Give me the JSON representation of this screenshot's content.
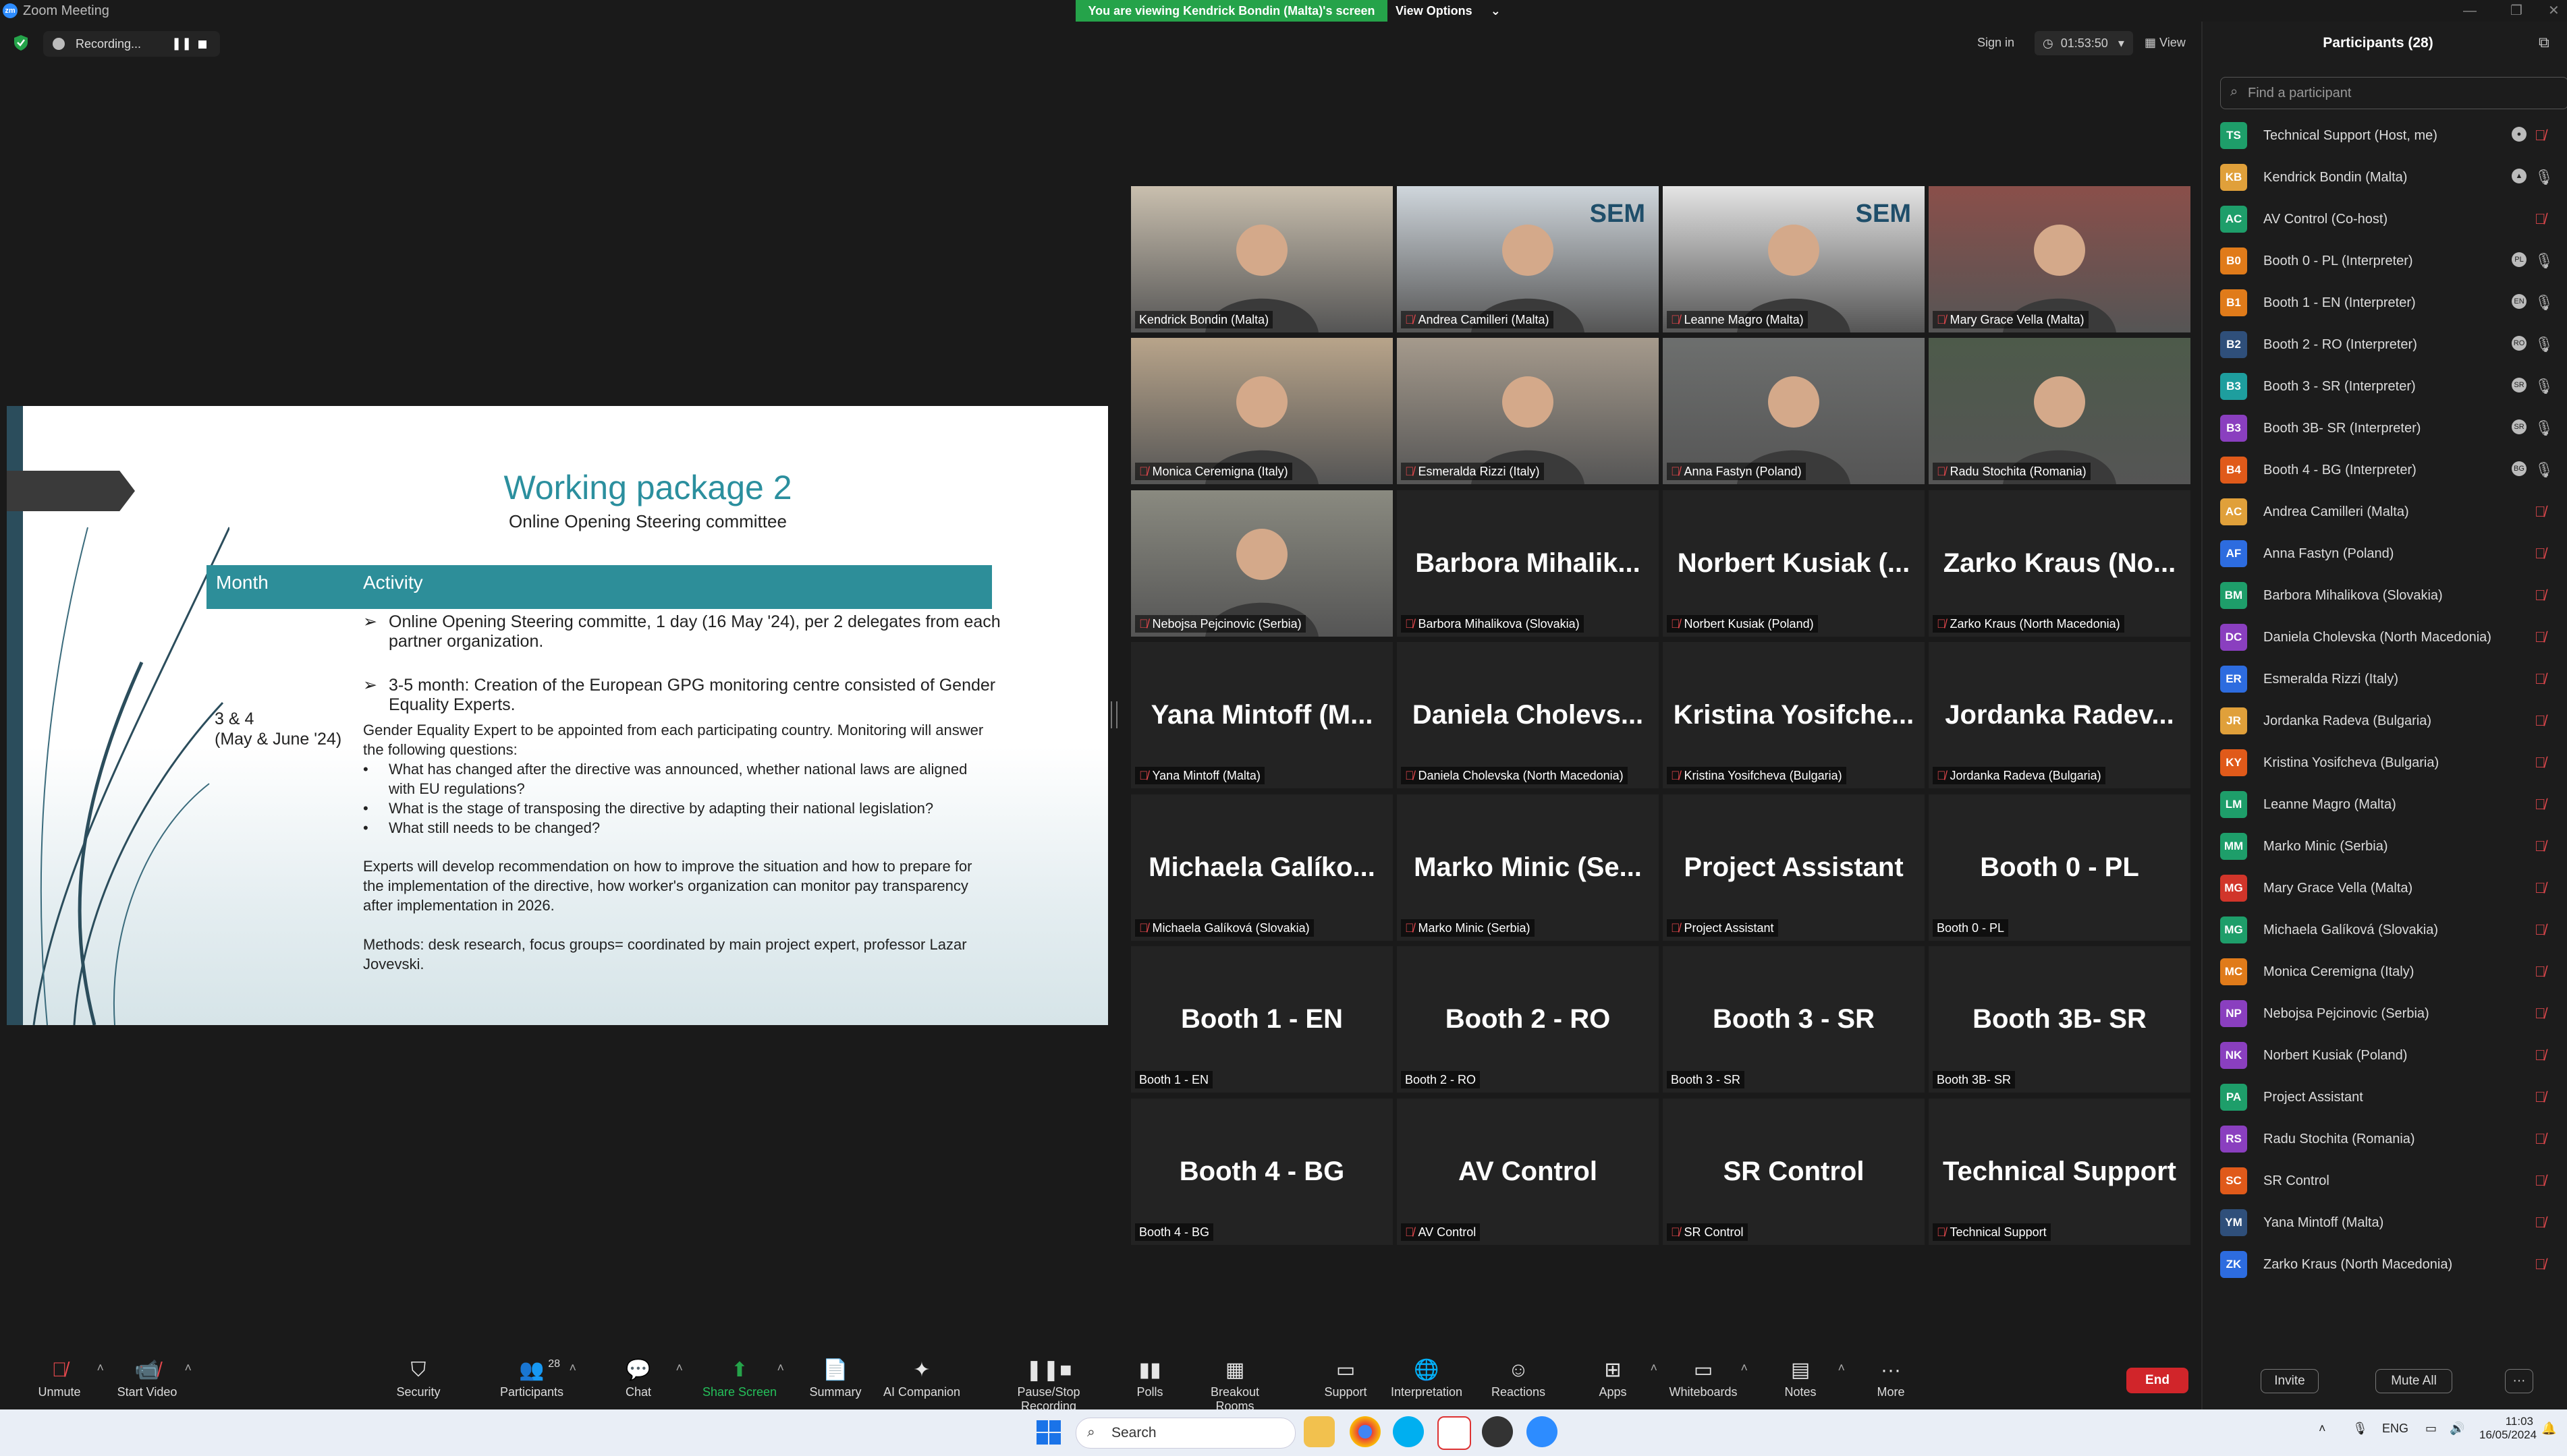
{
  "window": {
    "title": "Zoom Meeting"
  },
  "banner": {
    "text": "You are viewing Kendrick Bondin (Malta)'s screen",
    "view_options": "View Options"
  },
  "recording": {
    "label": "Recording..."
  },
  "topbar": {
    "sign_in": "Sign in",
    "timer": "01:53:50",
    "view": "View"
  },
  "slide": {
    "title": "Working package 2",
    "subtitle": "Online Opening Steering committee",
    "col_month": "Month",
    "col_activity": "Activity",
    "month_value": "3 & 4",
    "month_sub": "(May & June '24)",
    "bullet1": "Online Opening Steering committe, 1 day (16 May '24), per 2 delegates from each partner organization.",
    "bullet2": "3-5 month: Creation of the European GPG monitoring centre consisted of Gender Equality Experts.",
    "para1": "Gender Equality Expert to be appointed from each participating country. Monitoring will answer the following questions:",
    "q1": "What has changed after the directive was announced, whether national laws are aligned with EU regulations?",
    "q2": "What is the stage of transposing the directive by adapting their national legislation?",
    "q3": "What still needs to be changed?",
    "para2": "Experts will develop recommendation on how to improve the situation and how to prepare for the implementation of the directive, how worker's organization can monitor pay transparency after implementation in 2026.",
    "para3": "Methods: desk research, focus groups= coordinated by main project expert, professor Lazar Jovevski."
  },
  "tiles": [
    {
      "big": "",
      "label": "Kendrick Bondin (Malta)",
      "muted": false,
      "video": true,
      "active": true
    },
    {
      "big": "",
      "label": "Andrea Camilleri (Malta)",
      "muted": true,
      "video": true,
      "logo": "SEM"
    },
    {
      "big": "",
      "label": "Leanne Magro (Malta)",
      "muted": true,
      "video": true,
      "logo": "SEM"
    },
    {
      "big": "",
      "label": "Mary Grace Vella (Malta)",
      "muted": true,
      "video": true
    },
    {
      "big": "",
      "label": "Monica Ceremigna (Italy)",
      "muted": true,
      "video": true
    },
    {
      "big": "",
      "label": "Esmeralda Rizzi (Italy)",
      "muted": true,
      "video": true
    },
    {
      "big": "",
      "label": "Anna Fastyn (Poland)",
      "muted": true,
      "video": true
    },
    {
      "big": "",
      "label": "Radu Stochita (Romania)",
      "muted": true,
      "video": true
    },
    {
      "big": "",
      "label": "Nebojsa Pejcinovic (Serbia)",
      "muted": true,
      "video": true
    },
    {
      "big": "Barbora Mihalik...",
      "label": "Barbora Mihalikova (Slovakia)",
      "muted": true
    },
    {
      "big": "Norbert Kusiak (...",
      "label": "Norbert Kusiak (Poland)",
      "muted": true
    },
    {
      "big": "Zarko Kraus (No...",
      "label": "Zarko Kraus (North Macedonia)",
      "muted": true
    },
    {
      "big": "Yana Mintoff (M...",
      "label": "Yana Mintoff (Malta)",
      "muted": true
    },
    {
      "big": "Daniela Cholevs...",
      "label": "Daniela Cholevska (North Macedonia)",
      "muted": true
    },
    {
      "big": "Kristina Yosifche...",
      "label": "Kristina Yosifcheva (Bulgaria)",
      "muted": true
    },
    {
      "big": "Jordanka Radev...",
      "label": "Jordanka Radeva (Bulgaria)",
      "muted": true
    },
    {
      "big": "Michaela Galíko...",
      "label": "Michaela Galíková (Slovakia)",
      "muted": true
    },
    {
      "big": "Marko Minic (Se...",
      "label": "Marko Minic (Serbia)",
      "muted": true
    },
    {
      "big": "Project Assistant",
      "label": "Project Assistant",
      "muted": true
    },
    {
      "big": "Booth 0 - PL",
      "label": "Booth 0 - PL",
      "muted": false
    },
    {
      "big": "Booth 1 - EN",
      "label": "Booth 1 - EN",
      "muted": false
    },
    {
      "big": "Booth 2 - RO",
      "label": "Booth 2 - RO",
      "muted": false
    },
    {
      "big": "Booth 3 - SR",
      "label": "Booth 3 - SR",
      "muted": false
    },
    {
      "big": "Booth 3B- SR",
      "label": "Booth 3B- SR",
      "muted": false
    },
    {
      "big": "Booth 4 - BG",
      "label": "Booth 4 - BG",
      "muted": false
    },
    {
      "big": "AV Control",
      "label": "AV Control",
      "muted": true
    },
    {
      "big": "SR Control",
      "label": "SR Control",
      "muted": true
    },
    {
      "big": "Technical Support",
      "label": "Technical Support",
      "muted": true
    }
  ],
  "participants": {
    "title": "Participants (28)",
    "search_placeholder": "Find a participant",
    "list": [
      {
        "initials": "TS",
        "name": "Technical Support (Host, me)",
        "color": "#1e9e6a",
        "extra": "●"
      },
      {
        "initials": "KB",
        "name": "Kendrick Bondin (Malta)",
        "color": "#e0a03a",
        "extra": "▲",
        "unmuted": true
      },
      {
        "initials": "AC",
        "name": "AV Control (Co-host)",
        "color": "#1e9e6a"
      },
      {
        "initials": "B0",
        "name": "Booth 0 - PL (Interpreter)",
        "color": "#e07b1a",
        "extra": "PL",
        "unmuted": true
      },
      {
        "initials": "B1",
        "name": "Booth 1 - EN (Interpreter)",
        "color": "#e07b1a",
        "extra": "EN",
        "unmuted": true
      },
      {
        "initials": "B2",
        "name": "Booth 2 - RO (Interpreter)",
        "color": "#2f4f7a",
        "extra": "RO",
        "unmuted": true
      },
      {
        "initials": "B3",
        "name": "Booth 3 - SR (Interpreter)",
        "color": "#1e9e9e",
        "extra": "SR",
        "unmuted": true
      },
      {
        "initials": "B3",
        "name": "Booth 3B- SR (Interpreter)",
        "color": "#8a3fbf",
        "extra": "SR",
        "unmuted": true
      },
      {
        "initials": "B4",
        "name": "Booth 4 - BG (Interpreter)",
        "color": "#e05a1a",
        "extra": "BG",
        "unmuted": true
      },
      {
        "initials": "AC",
        "name": "Andrea Camilleri (Malta)",
        "color": "#e0a03a"
      },
      {
        "initials": "AF",
        "name": "Anna Fastyn (Poland)",
        "color": "#2d6cdf"
      },
      {
        "initials": "BM",
        "name": "Barbora Mihalikova (Slovakia)",
        "color": "#1e9e6a"
      },
      {
        "initials": "DC",
        "name": "Daniela Cholevska (North Macedonia)",
        "color": "#8a3fbf"
      },
      {
        "initials": "ER",
        "name": "Esmeralda Rizzi (Italy)",
        "color": "#2d6cdf"
      },
      {
        "initials": "JR",
        "name": "Jordanka Radeva (Bulgaria)",
        "color": "#e0a03a"
      },
      {
        "initials": "KY",
        "name": "Kristina Yosifcheva (Bulgaria)",
        "color": "#e05a1a"
      },
      {
        "initials": "LM",
        "name": "Leanne Magro (Malta)",
        "color": "#1e9e6a"
      },
      {
        "initials": "MM",
        "name": "Marko Minic (Serbia)",
        "color": "#1e9e6a"
      },
      {
        "initials": "MG",
        "name": "Mary Grace Vella (Malta)",
        "color": "#d1352a"
      },
      {
        "initials": "MG",
        "name": "Michaela Galíková (Slovakia)",
        "color": "#1e9e6a"
      },
      {
        "initials": "MC",
        "name": "Monica Ceremigna (Italy)",
        "color": "#e07b1a"
      },
      {
        "initials": "NP",
        "name": "Nebojsa Pejcinovic (Serbia)",
        "color": "#8a3fbf"
      },
      {
        "initials": "NK",
        "name": "Norbert Kusiak (Poland)",
        "color": "#8a3fbf"
      },
      {
        "initials": "PA",
        "name": "Project Assistant",
        "color": "#1e9e6a"
      },
      {
        "initials": "RS",
        "name": "Radu Stochita (Romania)",
        "color": "#8a3fbf"
      },
      {
        "initials": "SC",
        "name": "SR Control",
        "color": "#e05a1a"
      },
      {
        "initials": "YM",
        "name": "Yana Mintoff (Malta)",
        "color": "#2f4f7a"
      },
      {
        "initials": "ZK",
        "name": "Zarko Kraus (North Macedonia)",
        "color": "#2d6cdf"
      }
    ],
    "invite": "Invite",
    "mute_all": "Mute All",
    "more": "···"
  },
  "toolbar": [
    {
      "label": "Unmute",
      "icon": "mic-off-icon",
      "caret": true
    },
    {
      "label": "Start Video",
      "icon": "video-off-icon",
      "caret": true
    },
    {
      "label": "Security",
      "icon": "shield-icon"
    },
    {
      "label": "Participants",
      "icon": "participants-icon",
      "count": "28",
      "caret": true
    },
    {
      "label": "Chat",
      "icon": "chat-icon",
      "caret": true
    },
    {
      "label": "Share Screen",
      "icon": "share-screen-icon",
      "caret": true,
      "green": true
    },
    {
      "label": "Summary",
      "icon": "summary-icon"
    },
    {
      "label": "AI Companion",
      "icon": "ai-companion-icon"
    },
    {
      "label": "Pause/Stop Recording",
      "icon": "pause-stop-icon"
    },
    {
      "label": "Polls",
      "icon": "polls-icon"
    },
    {
      "label": "Breakout Rooms",
      "icon": "breakout-rooms-icon"
    },
    {
      "label": "Support",
      "icon": "support-icon"
    },
    {
      "label": "Interpretation",
      "icon": "globe-icon"
    },
    {
      "label": "Reactions",
      "icon": "reactions-icon"
    },
    {
      "label": "Apps",
      "icon": "apps-icon",
      "caret": true
    },
    {
      "label": "Whiteboards",
      "icon": "whiteboard-icon",
      "caret": true
    },
    {
      "label": "Notes",
      "icon": "notes-icon",
      "caret": true
    },
    {
      "label": "More",
      "icon": "more-icon"
    }
  ],
  "end_label": "End",
  "taskbar": {
    "search": "Search",
    "lang": "ENG",
    "time": "11:03",
    "date": "16/05/2024"
  }
}
